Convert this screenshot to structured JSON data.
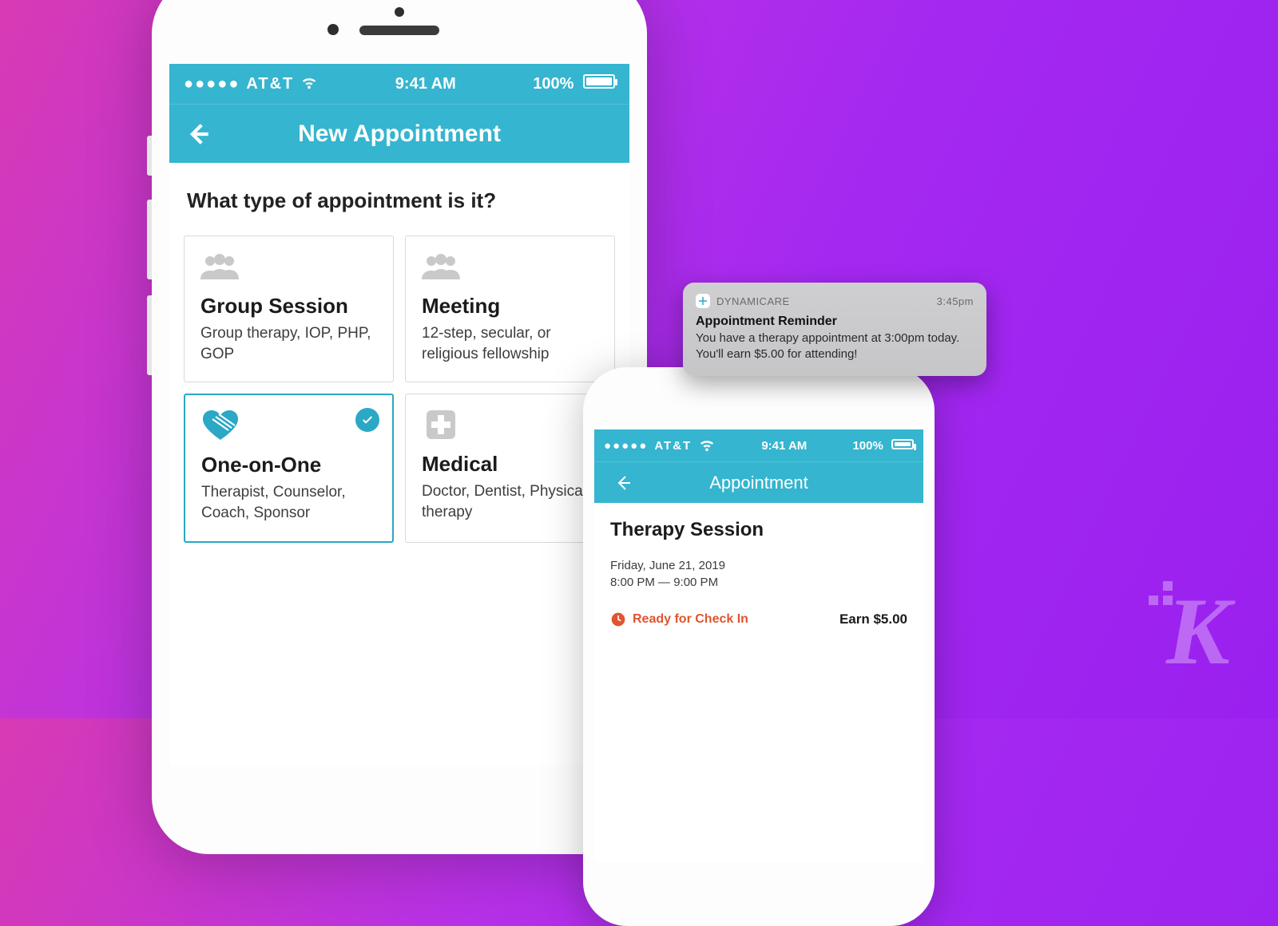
{
  "colors": {
    "accent": "#35b5cf",
    "warn": "#e0552f"
  },
  "phone_left": {
    "status": {
      "carrier": "AT&T",
      "time": "9:41 AM",
      "battery_pct": "100%"
    },
    "appbar": {
      "title": "New Appointment"
    },
    "prompt": "What type of appointment is it?",
    "cards": [
      {
        "title": "Group Session",
        "subtitle": "Group therapy, IOP, PHP, GOP",
        "selected": false,
        "icon": "people-icon"
      },
      {
        "title": "Meeting",
        "subtitle": "12-step, secular, or religious fellowship",
        "selected": false,
        "icon": "people-icon"
      },
      {
        "title": "One-on-One",
        "subtitle": "Therapist, Counselor, Coach, Sponsor",
        "selected": true,
        "icon": "heart-hands-icon"
      },
      {
        "title": "Medical",
        "subtitle": "Doctor, Dentist, Physical therapy",
        "selected": false,
        "icon": "medical-cross-icon"
      }
    ]
  },
  "phone_right": {
    "status": {
      "carrier": "AT&T",
      "time": "9:41 AM",
      "battery_pct": "100%"
    },
    "appbar": {
      "title": "Appointment"
    },
    "detail": {
      "title": "Therapy Session",
      "date": "Friday, June 21, 2019",
      "time": "8:00 PM — 9:00 PM",
      "status_label": "Ready for Check In",
      "earn_label": "Earn $5.00"
    }
  },
  "notification": {
    "app_name": "DYNAMICARE",
    "time": "3:45pm",
    "title": "Appointment Reminder",
    "body": "You have a therapy appointment at 3:00pm today. You'll earn $5.00 for attending!"
  },
  "watermark": "K"
}
